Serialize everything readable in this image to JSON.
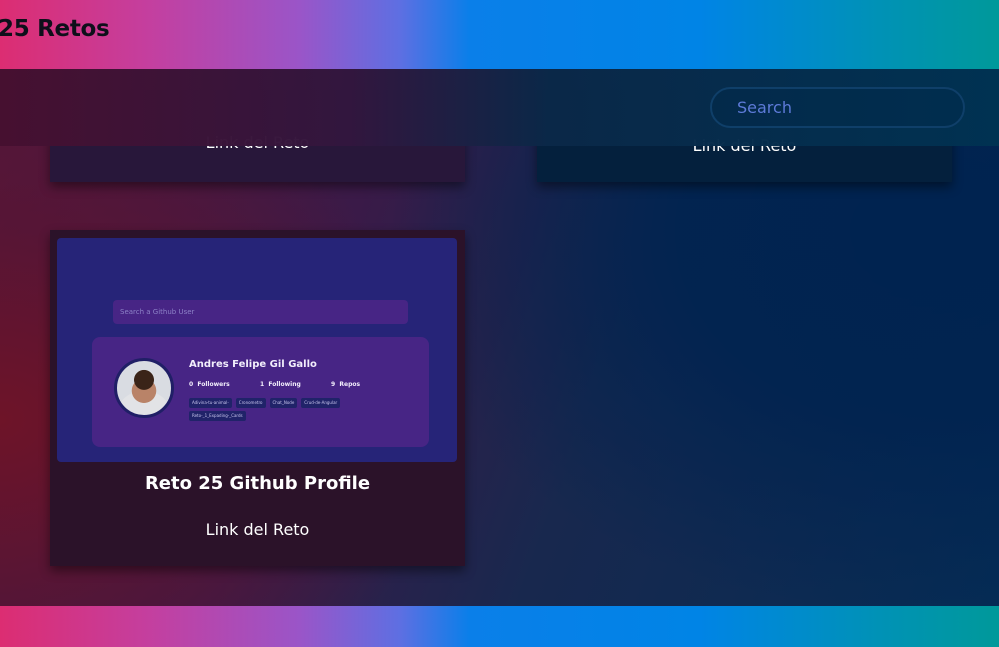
{
  "header": {
    "title": "25 Retos"
  },
  "search": {
    "placeholder": "Search"
  },
  "cards_top": [
    {
      "link_label": "Link del Reto"
    },
    {
      "link_label": "Link del Reto"
    }
  ],
  "card_main": {
    "title": "Reto 25 Github Profile",
    "link_label": "Link del Reto",
    "preview": {
      "search_placeholder": "Search a Github User",
      "user_name": "Andres Felipe Gil Gallo",
      "followers_count": "0",
      "followers_label": "Followers",
      "following_count": "1",
      "following_label": "Following",
      "repos_count": "9",
      "repos_label": "Repos",
      "repos": [
        "Adivina-tu-animal-",
        "Cronometro",
        "Chat_Node",
        "Crud-de-Angular",
        "Reto-_1_Expading-_Cards"
      ]
    }
  },
  "colors": {
    "header_gradient_start": "#dc2d72",
    "header_gradient_mid": "#0084e6",
    "header_gradient_end": "#00999a",
    "search_text": "#5d7ad8"
  }
}
